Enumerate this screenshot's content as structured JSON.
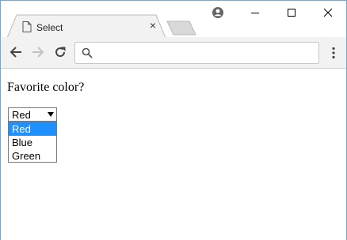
{
  "tab": {
    "title": "Select",
    "close_glyph": "×"
  },
  "icons": {
    "page": "page-icon",
    "profile": "profile-icon",
    "minimize": "minimize-icon",
    "maximize": "maximize-icon",
    "close": "close-icon",
    "back": "back-arrow-icon",
    "forward": "forward-arrow-icon",
    "reload": "reload-icon",
    "search": "search-icon",
    "menu": "kebab-menu-icon"
  },
  "omnibox": {
    "value": "",
    "placeholder": ""
  },
  "page": {
    "question": "Favorite color?",
    "select": {
      "value": "Red",
      "options": [
        "Red",
        "Blue",
        "Green"
      ],
      "highlighted_index": 0
    }
  },
  "colors": {
    "highlight": "#1e90ff",
    "window_border": "#6fa8d8"
  }
}
